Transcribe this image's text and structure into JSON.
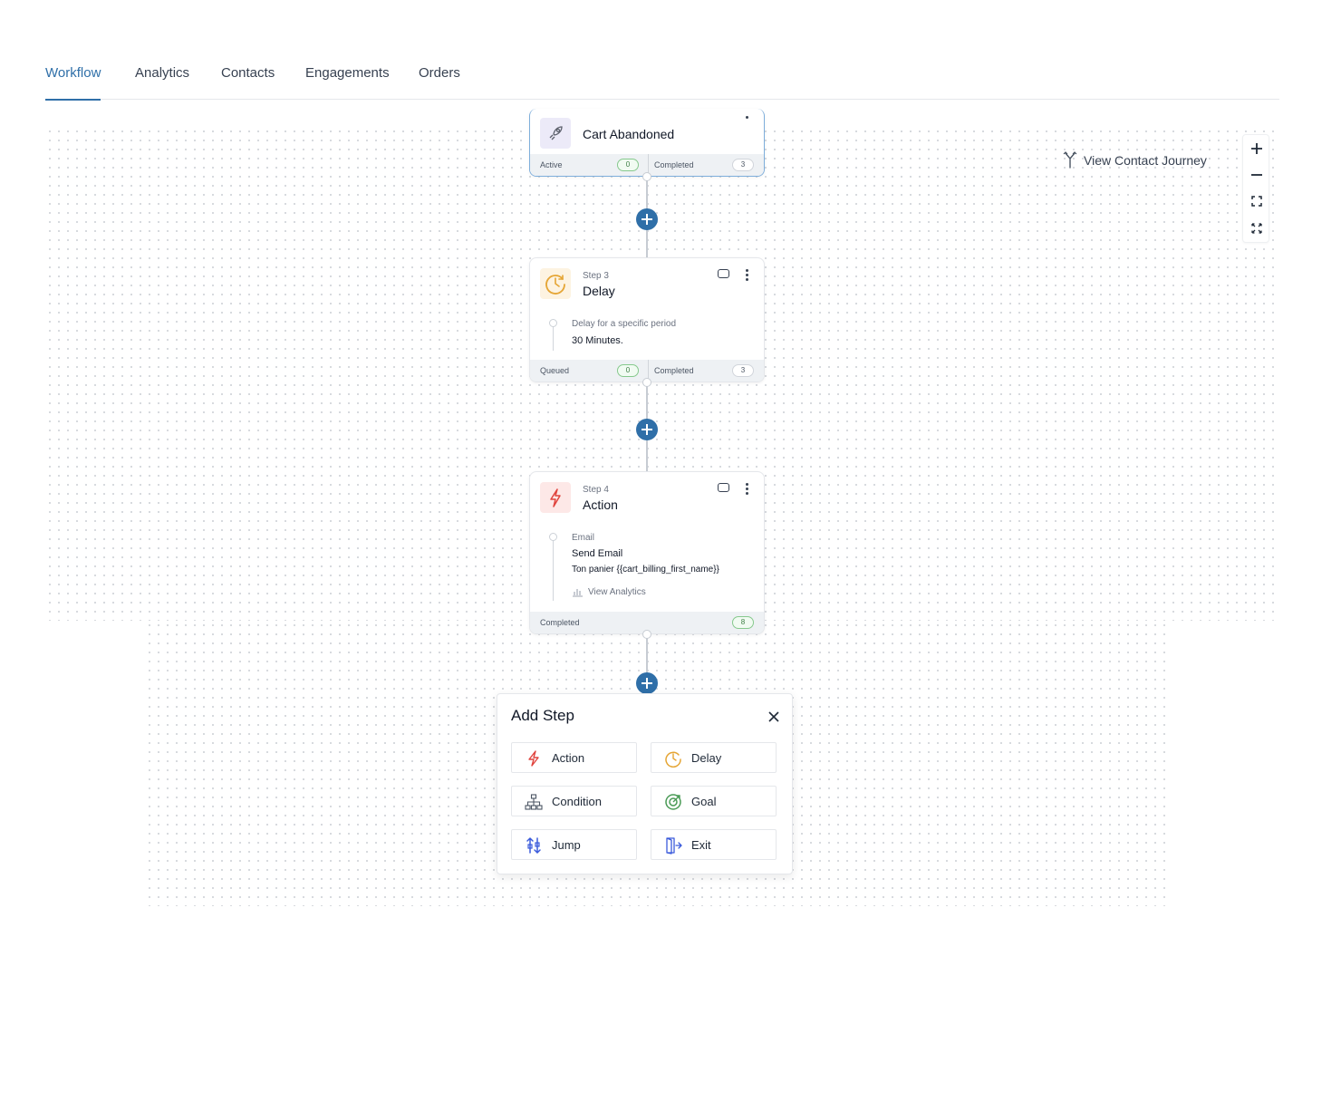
{
  "tabs": [
    {
      "label": "Workflow",
      "active": true
    },
    {
      "label": "Analytics",
      "active": false
    },
    {
      "label": "Contacts",
      "active": false
    },
    {
      "label": "Engagements",
      "active": false
    },
    {
      "label": "Orders",
      "active": false
    }
  ],
  "toolbar": {
    "view_contact_journey": "View Contact Journey",
    "zoom_in_icon": "plus-icon",
    "zoom_out_icon": "minus-icon",
    "fit_icon": "fit-screen-icon",
    "fullscreen_icon": "fullscreen-icon"
  },
  "trigger_card": {
    "title": "Cart Abandoned",
    "icon": "rocket-icon",
    "footer": {
      "left_label": "Active",
      "left_count": "0",
      "right_label": "Completed",
      "right_count": "3"
    }
  },
  "delay_card": {
    "step": "Step 3",
    "title": "Delay",
    "icon": "clock-icon",
    "detail_label": "Delay for a specific period",
    "detail_value": "30 Minutes.",
    "footer": {
      "left_label": "Queued",
      "left_count": "0",
      "right_label": "Completed",
      "right_count": "3"
    }
  },
  "action_card": {
    "step": "Step 4",
    "title": "Action",
    "icon": "lightning-icon",
    "detail_label": "Email",
    "detail_value": "Send Email",
    "detail_subject": "Ton panier {{cart_billing_first_name}}",
    "analytics_link": "View Analytics",
    "footer": {
      "label": "Completed",
      "count": "8"
    }
  },
  "add_step": {
    "title": "Add Step",
    "options": [
      {
        "label": "Action",
        "icon": "lightning-icon"
      },
      {
        "label": "Delay",
        "icon": "clock-icon"
      },
      {
        "label": "Condition",
        "icon": "branch-icon"
      },
      {
        "label": "Goal",
        "icon": "target-icon"
      },
      {
        "label": "Jump",
        "icon": "jump-icon"
      },
      {
        "label": "Exit",
        "icon": "exit-icon"
      }
    ]
  },
  "colors": {
    "accent": "#2f6fa8",
    "delay": "#e5a534",
    "action": "#e0443e",
    "goal": "#4b9b57",
    "jump_exit": "#3b5bdb"
  }
}
